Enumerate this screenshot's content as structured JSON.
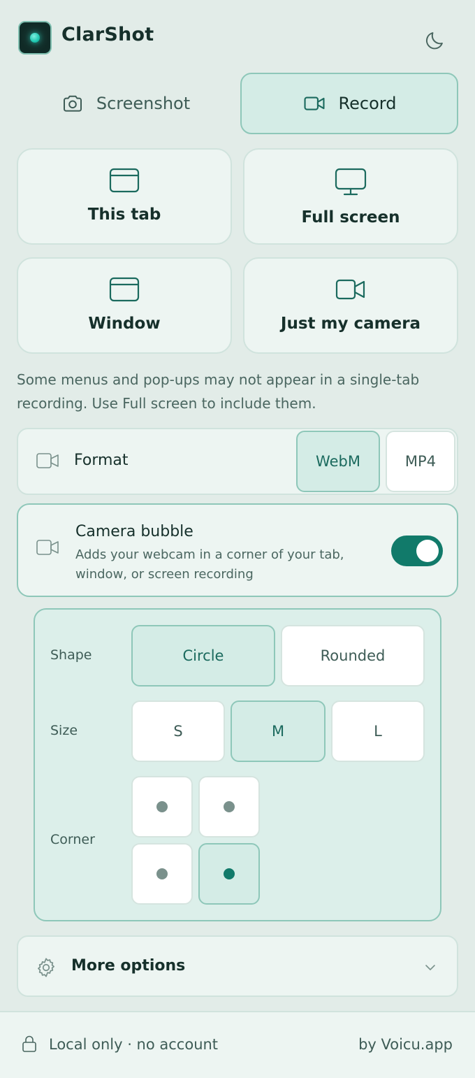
{
  "app": {
    "title": "ClarShot"
  },
  "modes": [
    {
      "label": "Screenshot",
      "icon": "camera-icon",
      "active": false
    },
    {
      "label": "Record",
      "icon": "video-icon",
      "active": true
    }
  ],
  "capture_options": [
    {
      "label": "This tab",
      "icon": "browser-window-icon"
    },
    {
      "label": "Full screen",
      "icon": "monitor-icon"
    },
    {
      "label": "Window",
      "icon": "window-icon"
    },
    {
      "label": "Just my camera",
      "icon": "video-camera-icon"
    }
  ],
  "note": "Some menus and pop-ups may not appear in a single-tab recording. Use Full screen to include them.",
  "format": {
    "label": "Format",
    "options": [
      "WebM",
      "MP4"
    ],
    "selected": "WebM"
  },
  "camera_bubble": {
    "title": "Camera bubble",
    "description": "Adds your webcam in a corner of your tab, window, or screen recording",
    "enabled": true
  },
  "bubble_settings": {
    "shape": {
      "label": "Shape",
      "options": [
        "Circle",
        "Rounded"
      ],
      "selected": "Circle"
    },
    "size": {
      "label": "Size",
      "options": [
        "S",
        "M",
        "L"
      ],
      "selected": "M"
    },
    "corner": {
      "label": "Corner",
      "options": [
        "top-left",
        "top-right",
        "bottom-left",
        "bottom-right"
      ],
      "selected": "bottom-right"
    }
  },
  "more_options": {
    "label": "More options"
  },
  "footer": {
    "privacy": "Local only · no account",
    "credit": "by Voicu.app"
  },
  "colors": {
    "accent": "#117a6a",
    "background": "#e2ece8",
    "selected_fill": "#d4ece6",
    "selected_border": "#8ec7b9"
  }
}
